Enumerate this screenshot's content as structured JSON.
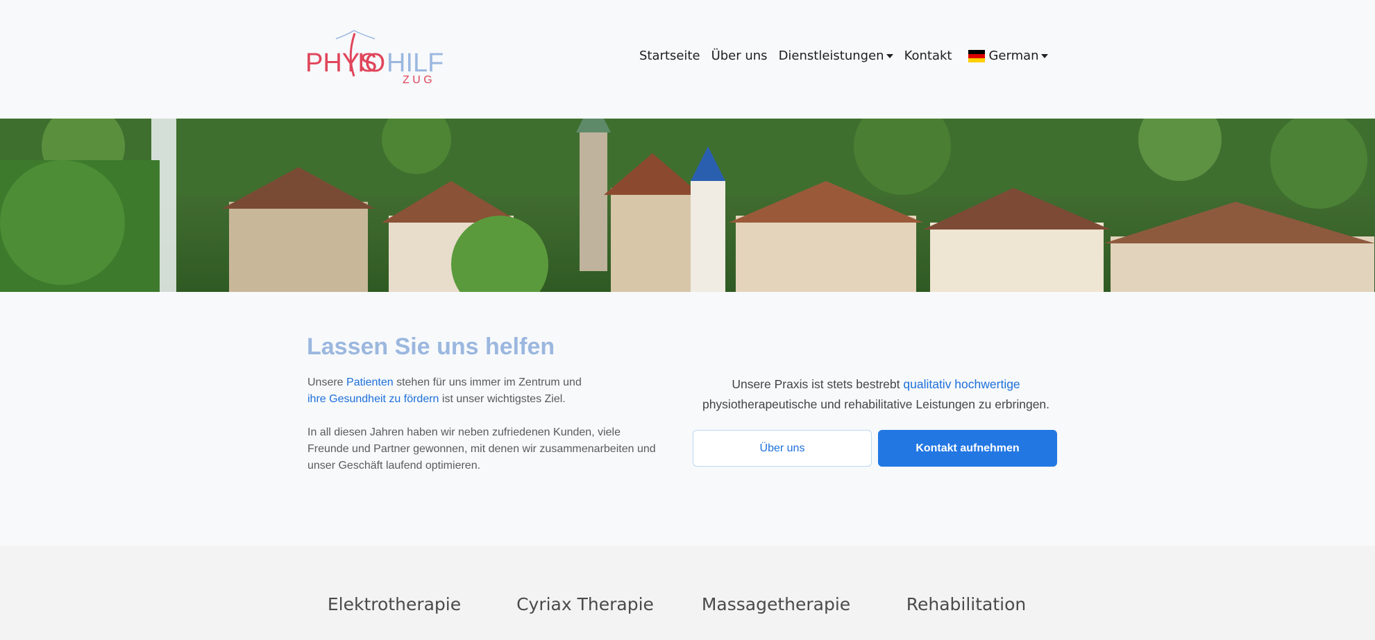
{
  "logo": {
    "physio": "PHYS",
    "io": "IO",
    "hilfe": "HILFE",
    "zug": "Z U G",
    "brand_red": "#e0455a",
    "brand_blue": "#9bb7df"
  },
  "nav": {
    "items": [
      "Startseite",
      "Über uns",
      "Dienstleistungen",
      "Kontakt"
    ],
    "language": "German"
  },
  "intro": {
    "title": "Lassen Sie uns helfen",
    "p1_a": "Unsere ",
    "p1_link1": "Patienten",
    "p1_b": " stehen für uns immer im Zentrum und",
    "p1_link2": "ihre Gesundheit zu fördern",
    "p1_c": " ist unser wichtigstes Ziel.",
    "p2": "In all diesen Jahren haben wir neben zufriedenen Kunden, viele Freunde und Partner gewonnen, mit denen wir zusammenarbeiten und unser Geschäft laufend optimieren."
  },
  "cta": {
    "text_a": "Unsere Praxis ist stets bestrebt ",
    "text_link": "qualitativ hochwertige",
    "text_b": "physiotherapeutische und rehabilitative Leistungen zu erbringen.",
    "about_button": "Über uns",
    "contact_button": "Kontakt aufnehmen"
  },
  "services": [
    "Elektrotherapie",
    "Cyriax Therapie",
    "Massagetherapie",
    "Rehabilitation"
  ]
}
